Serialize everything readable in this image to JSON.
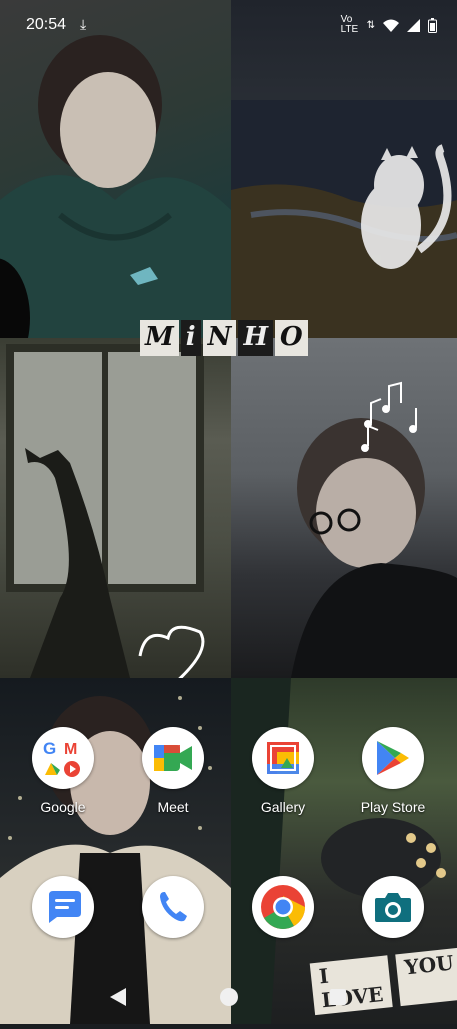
{
  "status_bar": {
    "time": "20:54",
    "network_label": "Vo LTE"
  },
  "wallpaper": {
    "caption_letters": [
      "M",
      "i",
      "N",
      "H",
      "O"
    ],
    "sticker_words": [
      "I LOVE",
      "YOU"
    ]
  },
  "apps": [
    {
      "label": "Google",
      "icon": "google-folder-icon"
    },
    {
      "label": "Meet",
      "icon": "meet-icon"
    },
    {
      "label": "Gallery",
      "icon": "gallery-icon"
    },
    {
      "label": "Play Store",
      "icon": "play-store-icon"
    }
  ],
  "dock": [
    {
      "icon": "messages-icon"
    },
    {
      "icon": "phone-icon"
    },
    {
      "icon": "chrome-icon"
    },
    {
      "icon": "camera-icon"
    }
  ],
  "colors": {
    "google_blue": "#4285F4",
    "google_red": "#EA4335",
    "google_yellow": "#FBBC04",
    "google_green": "#34A853",
    "camera_teal": "#0F6F7E"
  }
}
